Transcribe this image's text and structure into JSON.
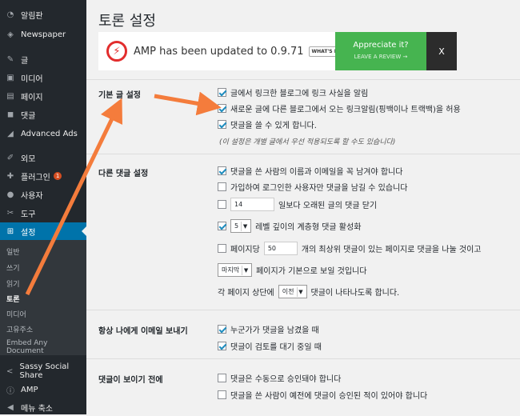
{
  "sidebar": {
    "items": [
      {
        "label": "알림판",
        "icon": "dashboard-icon"
      },
      {
        "label": "Newspaper",
        "icon": "newspaper-icon"
      },
      {
        "label": "글",
        "icon": "pin-icon"
      },
      {
        "label": "미디어",
        "icon": "media-icon"
      },
      {
        "label": "페이지",
        "icon": "page-icon"
      },
      {
        "label": "댓글",
        "icon": "comment-icon"
      },
      {
        "label": "Advanced Ads",
        "icon": "ads-icon"
      },
      {
        "label": "외모",
        "icon": "brush-icon"
      },
      {
        "label": "플러그인",
        "icon": "plugin-icon",
        "badge": "1"
      },
      {
        "label": "사용자",
        "icon": "user-icon"
      },
      {
        "label": "도구",
        "icon": "wrench-icon"
      },
      {
        "label": "설정",
        "icon": "settings-icon",
        "active": true
      }
    ],
    "submenu": [
      "일반",
      "쓰기",
      "읽기",
      "토론",
      "미디어",
      "고유주소",
      "Embed Any Document"
    ],
    "submenu_current": "토론",
    "bottom_items": [
      {
        "label": "Sassy Social Share",
        "icon": "share-icon"
      },
      {
        "label": "AMP",
        "icon": "amp-icon"
      },
      {
        "label": "메뉴 축소",
        "icon": "collapse-icon"
      }
    ]
  },
  "page_title": "토론 설정",
  "amp_banner": {
    "message": "AMP has been updated to 0.9.71",
    "whats_new": "WHAT'S NEW?",
    "appreciate_title": "Appreciate it?",
    "appreciate_link": "LEAVE A REVIEW →",
    "close": "X",
    "accent": "#46b450"
  },
  "sections": {
    "default_post": {
      "label": "기본 글 설정",
      "options": [
        "글에서 링크한 블로그에 링크 사실을 알림",
        "새로운 글에 다른 블로그에서 오는 링크알림(핑백이나 트랙백)을 허용",
        "댓글을 쓸 수 있게 합니다."
      ],
      "note": "(이 설정은 개별 글에서 우선 적용되도록 할 수도 있습니다)"
    },
    "other_comment": {
      "label": "다른 댓글 설정",
      "opt1": "댓글을 쓴 사람의 이름과 이메일을 꼭 남겨야 합니다",
      "opt2": "가입하여 로그인한 사용자만 댓글을 남길 수 있습니다",
      "close_days_value": "14",
      "close_days_text": "일보다 오래된 글의 댓글 닫기",
      "thread_value": "5",
      "thread_text": "레벨 깊이의 계층형 댓글 활성화",
      "paginate_pre": "페이지당",
      "paginate_value": "50",
      "paginate_text": "개의 최상위 댓글이 있는 페이지로 댓글을 나눌 것이고",
      "default_page_value": "마지막",
      "default_page_text": "페이지가 기본으로 보일 것입니다",
      "order_pre": "각 페이지 상단에",
      "order_value": "이전",
      "order_text": "댓글이 나타나도록 합니다."
    },
    "email_me": {
      "label": "항상 나에게 이메일 보내기",
      "options": [
        "누군가가 댓글을 남겼을 때",
        "댓글이 검토를 대기 중일 때"
      ]
    },
    "before_appear": {
      "label": "댓글이 보이기 전에",
      "options": [
        "댓글은 수동으로 승인돼야 합니다",
        "댓글을 쓴 사람이 예전에 댓글이 승인된 적이 있어야 합니다"
      ]
    }
  },
  "colors": {
    "sidebar_bg": "#23282d",
    "active": "#0073aa",
    "arrow": "#f47c3c"
  }
}
